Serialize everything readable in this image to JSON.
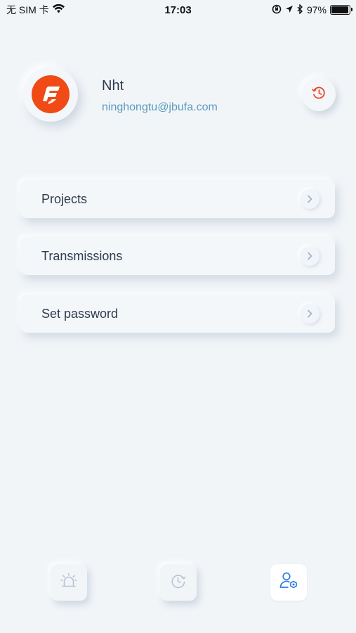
{
  "status_bar": {
    "carrier": "无 SIM 卡",
    "time": "17:03",
    "battery_percent": "97%",
    "battery_level": 0.97
  },
  "profile": {
    "name": "Nht",
    "email": "ninghongtu@jbufa.com",
    "logo_icon": "brand-logo-icon",
    "action_icon": "history-clock-icon"
  },
  "menu": {
    "items": [
      {
        "label": "Projects",
        "icon": "chevron-right-icon"
      },
      {
        "label": "Transmissions",
        "icon": "chevron-right-icon"
      },
      {
        "label": "Set password",
        "icon": "chevron-right-icon"
      }
    ]
  },
  "tab_bar": {
    "tabs": [
      {
        "icon": "alarm-icon",
        "active": false
      },
      {
        "icon": "history-clock-icon",
        "active": false
      },
      {
        "icon": "user-settings-icon",
        "active": true
      }
    ]
  },
  "colors": {
    "background": "#f2f5f8",
    "accent_orange": "#f04a16",
    "email_blue": "#5b9bbf",
    "active_blue": "#2f7fe0",
    "inactive_icon": "#b6c3d3"
  }
}
